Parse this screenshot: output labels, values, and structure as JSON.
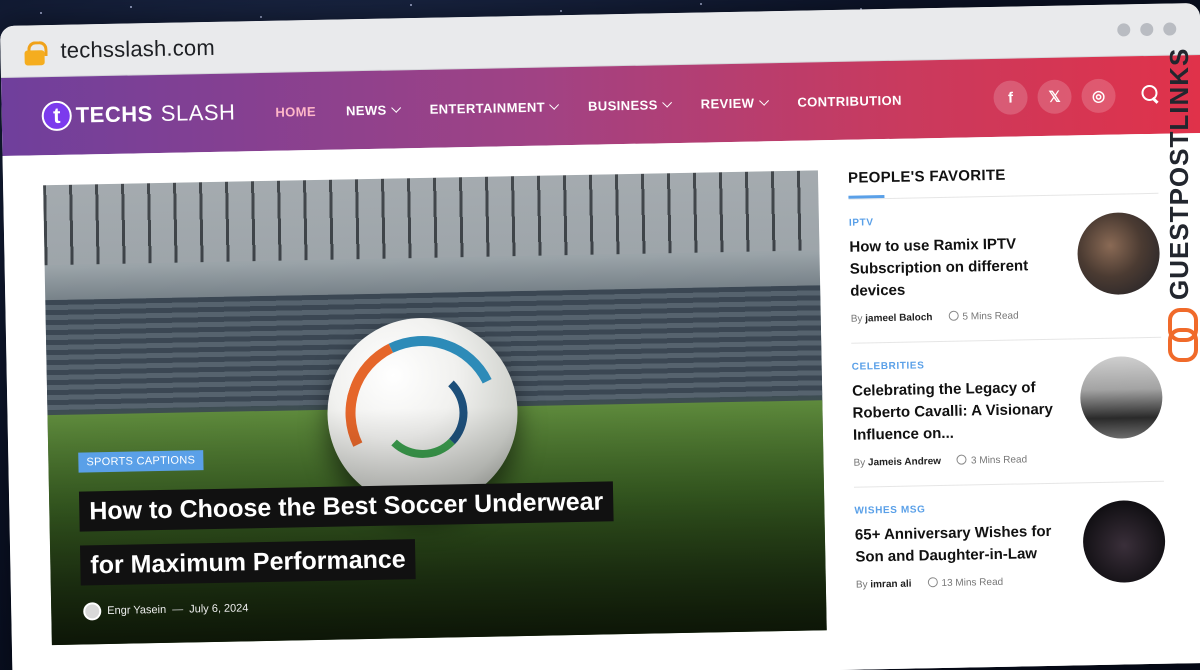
{
  "browser": {
    "url": "techsslash.com"
  },
  "logo": {
    "mark": "t",
    "text_bold": "TECHS",
    "text_light": "SLASH"
  },
  "nav": {
    "items": [
      {
        "label": "HOME",
        "active": true,
        "dropdown": false
      },
      {
        "label": "NEWS",
        "active": false,
        "dropdown": true
      },
      {
        "label": "ENTERTAINMENT",
        "active": false,
        "dropdown": true
      },
      {
        "label": "BUSINESS",
        "active": false,
        "dropdown": true
      },
      {
        "label": "REVIEW",
        "active": false,
        "dropdown": true
      },
      {
        "label": "CONTRIBUTION",
        "active": false,
        "dropdown": false
      }
    ],
    "socials": [
      "facebook-icon",
      "x-icon",
      "instagram-icon"
    ],
    "gradient": [
      "#6f3f9c",
      "#e0324a"
    ]
  },
  "hero": {
    "category": "SPORTS CAPTIONS",
    "title_line1": "How to Choose the Best Soccer Underwear",
    "title_line2": "for Maximum Performance",
    "author": "Engr Yasein",
    "date": "July 6, 2024"
  },
  "sidebar": {
    "heading": "PEOPLE'S FAVORITE",
    "accent": "#5aa0e8",
    "cards": [
      {
        "category": "IPTV",
        "title": "How to use Ramix IPTV Subscription on different devices",
        "by": "By",
        "author": "jameel Baloch",
        "read": "5 Mins Read"
      },
      {
        "category": "CELEBRITIES",
        "title": "Celebrating the Legacy of Roberto Cavalli: A Visionary Influence on...",
        "by": "By",
        "author": "Jameis Andrew",
        "read": "3 Mins Read"
      },
      {
        "category": "WISHES MSG",
        "title": "65+ Anniversary Wishes for Son and Daughter-in-Law",
        "by": "By",
        "author": "imran ali",
        "read": "13 Mins Read"
      }
    ]
  },
  "watermark": {
    "text": "GUESTPOSTLINKS"
  }
}
